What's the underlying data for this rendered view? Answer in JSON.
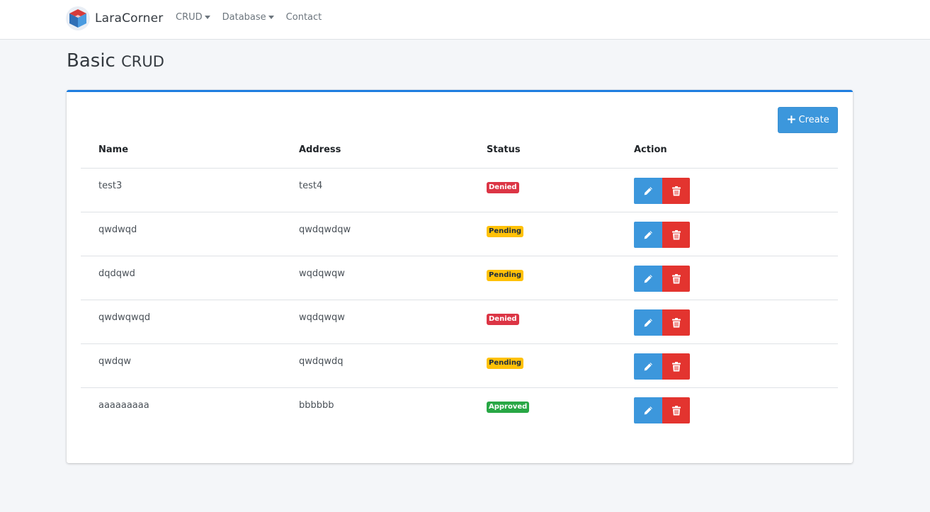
{
  "navbar": {
    "brand": "LaraCorner",
    "links": [
      {
        "label": "CRUD",
        "dropdown": true
      },
      {
        "label": "Database",
        "dropdown": true
      },
      {
        "label": "Contact",
        "dropdown": false
      }
    ]
  },
  "page": {
    "title_main": "Basic",
    "title_sub": "CRUD"
  },
  "card": {
    "create_label": "Create",
    "columns": {
      "name": "Name",
      "address": "Address",
      "status": "Status",
      "action": "Action"
    },
    "rows": [
      {
        "name": "test3",
        "address": "test4",
        "status": "Denied"
      },
      {
        "name": "qwdwqd",
        "address": "qwdqwdqw",
        "status": "Pending"
      },
      {
        "name": "dqdqwd",
        "address": "wqdqwqw",
        "status": "Pending"
      },
      {
        "name": "qwdwqwqd",
        "address": "wqdqwqw",
        "status": "Denied"
      },
      {
        "name": "qwdqw",
        "address": "qwdqwdq",
        "status": "Pending"
      },
      {
        "name": "aaaaaaaaa",
        "address": "bbbbbb",
        "status": "Approved"
      }
    ]
  },
  "colors": {
    "primary": "#3c97dc",
    "card_accent": "#1e7ee0",
    "danger": "#e3342f",
    "denied": "#dc3545",
    "pending": "#ffc107",
    "approved": "#28a745",
    "background": "#f4f6f9"
  },
  "icons": {
    "create": "plus-icon",
    "edit": "pencil-icon",
    "delete": "trash-icon"
  }
}
